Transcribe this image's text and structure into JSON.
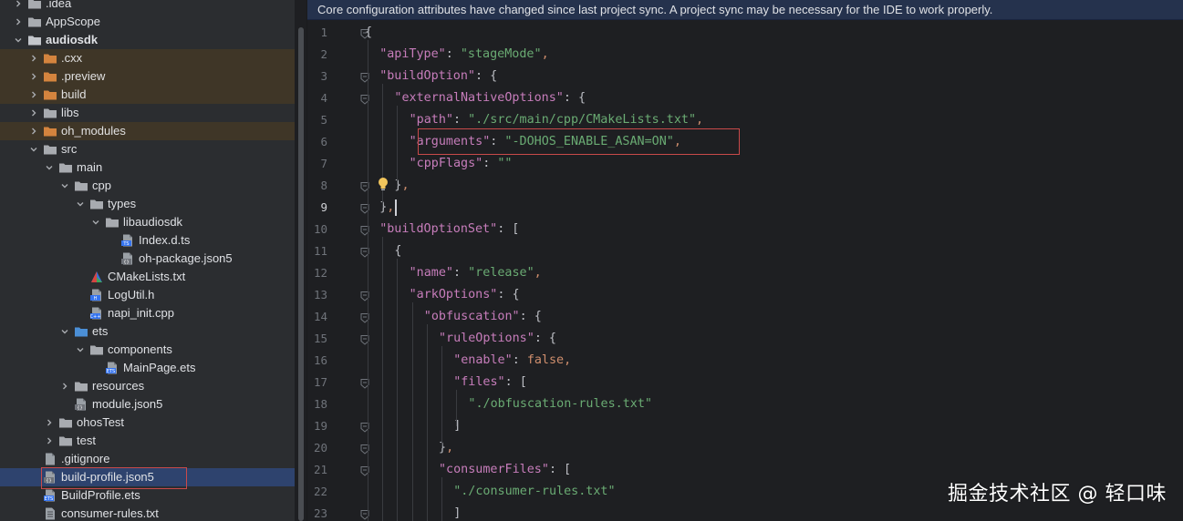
{
  "tree": {
    "items": [
      {
        "label": ".idea",
        "depth": 1,
        "kind": "folder",
        "expanded": false,
        "state": ""
      },
      {
        "label": "AppScope",
        "depth": 1,
        "kind": "folder",
        "expanded": false,
        "state": ""
      },
      {
        "label": "audiosdk",
        "depth": 1,
        "kind": "module",
        "expanded": true,
        "state": "",
        "bold": true
      },
      {
        "label": ".cxx",
        "depth": 2,
        "kind": "folder-orange",
        "expanded": false,
        "state": "excluded"
      },
      {
        "label": ".preview",
        "depth": 2,
        "kind": "folder-orange",
        "expanded": false,
        "state": "excluded"
      },
      {
        "label": "build",
        "depth": 2,
        "kind": "folder-orange",
        "expanded": false,
        "state": "excluded"
      },
      {
        "label": "libs",
        "depth": 2,
        "kind": "folder",
        "expanded": false,
        "state": ""
      },
      {
        "label": "oh_modules",
        "depth": 2,
        "kind": "folder-orange",
        "expanded": false,
        "state": "excluded"
      },
      {
        "label": "src",
        "depth": 2,
        "kind": "folder",
        "expanded": true,
        "state": ""
      },
      {
        "label": "main",
        "depth": 3,
        "kind": "folder",
        "expanded": true,
        "state": ""
      },
      {
        "label": "cpp",
        "depth": 4,
        "kind": "folder",
        "expanded": true,
        "state": ""
      },
      {
        "label": "types",
        "depth": 5,
        "kind": "folder",
        "expanded": true,
        "state": ""
      },
      {
        "label": "libaudiosdk",
        "depth": 6,
        "kind": "folder",
        "expanded": true,
        "state": ""
      },
      {
        "label": "Index.d.ts",
        "depth": 7,
        "kind": "ts",
        "state": ""
      },
      {
        "label": "oh-package.json5",
        "depth": 7,
        "kind": "json5",
        "state": ""
      },
      {
        "label": "CMakeLists.txt",
        "depth": 5,
        "kind": "cmake",
        "state": ""
      },
      {
        "label": "LogUtil.h",
        "depth": 5,
        "kind": "h",
        "state": ""
      },
      {
        "label": "napi_init.cpp",
        "depth": 5,
        "kind": "cpp",
        "state": ""
      },
      {
        "label": "ets",
        "depth": 4,
        "kind": "folder-blue",
        "expanded": true,
        "state": ""
      },
      {
        "label": "components",
        "depth": 5,
        "kind": "folder",
        "expanded": true,
        "state": ""
      },
      {
        "label": "MainPage.ets",
        "depth": 6,
        "kind": "ets",
        "state": ""
      },
      {
        "label": "resources",
        "depth": 4,
        "kind": "folder",
        "expanded": false,
        "state": ""
      },
      {
        "label": "module.json5",
        "depth": 4,
        "kind": "json5",
        "state": ""
      },
      {
        "label": "ohosTest",
        "depth": 3,
        "kind": "folder",
        "expanded": false,
        "state": ""
      },
      {
        "label": "test",
        "depth": 3,
        "kind": "folder",
        "expanded": false,
        "state": ""
      },
      {
        "label": ".gitignore",
        "depth": 2,
        "kind": "gitignore",
        "state": ""
      },
      {
        "label": "build-profile.json5",
        "depth": 2,
        "kind": "json5",
        "state": "selected"
      },
      {
        "label": "BuildProfile.ets",
        "depth": 2,
        "kind": "ets",
        "state": ""
      },
      {
        "label": "consumer-rules.txt",
        "depth": 2,
        "kind": "txt",
        "state": ""
      }
    ]
  },
  "editor": {
    "banner": "Core configuration attributes have changed since last project sync. A project sync may be necessary for the IDE to work properly.",
    "current_line": 9,
    "lines": [
      {
        "n": "1",
        "indent": 0,
        "tokens": [
          [
            "p",
            "{"
          ]
        ]
      },
      {
        "n": "2",
        "indent": 1,
        "tokens": [
          [
            "k",
            "\"apiType\""
          ],
          [
            "p",
            ": "
          ],
          [
            "s",
            "\"stageMode\""
          ],
          [
            "b",
            ","
          ]
        ]
      },
      {
        "n": "3",
        "indent": 1,
        "tokens": [
          [
            "k",
            "\"buildOption\""
          ],
          [
            "p",
            ": {"
          ]
        ]
      },
      {
        "n": "4",
        "indent": 2,
        "tokens": [
          [
            "k",
            "\"externalNativeOptions\""
          ],
          [
            "p",
            ": {"
          ]
        ]
      },
      {
        "n": "5",
        "indent": 3,
        "tokens": [
          [
            "k",
            "\"path\""
          ],
          [
            "p",
            ": "
          ],
          [
            "s",
            "\"./src/main/cpp/CMakeLists.txt\""
          ],
          [
            "b",
            ","
          ]
        ]
      },
      {
        "n": "6",
        "indent": 3,
        "tokens": [
          [
            "k",
            "\"arguments\""
          ],
          [
            "p",
            ": "
          ],
          [
            "s",
            "\"-DOHOS_ENABLE_ASAN=ON\""
          ],
          [
            "b",
            ","
          ]
        ]
      },
      {
        "n": "7",
        "indent": 3,
        "tokens": [
          [
            "k",
            "\"cppFlags\""
          ],
          [
            "p",
            ": "
          ],
          [
            "s",
            "\"\""
          ]
        ]
      },
      {
        "n": "8",
        "indent": 2,
        "tokens": [
          [
            "p",
            "}"
          ],
          [
            "b",
            ","
          ]
        ]
      },
      {
        "n": "9",
        "indent": 1,
        "tokens": [
          [
            "p",
            "}"
          ],
          [
            "b",
            ","
          ]
        ]
      },
      {
        "n": "10",
        "indent": 1,
        "tokens": [
          [
            "k",
            "\"buildOptionSet\""
          ],
          [
            "p",
            ": ["
          ]
        ]
      },
      {
        "n": "11",
        "indent": 2,
        "tokens": [
          [
            "p",
            "{"
          ]
        ]
      },
      {
        "n": "12",
        "indent": 3,
        "tokens": [
          [
            "k",
            "\"name\""
          ],
          [
            "p",
            ": "
          ],
          [
            "s",
            "\"release\""
          ],
          [
            "b",
            ","
          ]
        ]
      },
      {
        "n": "13",
        "indent": 3,
        "tokens": [
          [
            "k",
            "\"arkOptions\""
          ],
          [
            "p",
            ": {"
          ]
        ]
      },
      {
        "n": "14",
        "indent": 4,
        "tokens": [
          [
            "k",
            "\"obfuscation\""
          ],
          [
            "p",
            ": {"
          ]
        ]
      },
      {
        "n": "15",
        "indent": 5,
        "tokens": [
          [
            "k",
            "\"ruleOptions\""
          ],
          [
            "p",
            ": {"
          ]
        ]
      },
      {
        "n": "16",
        "indent": 6,
        "tokens": [
          [
            "k",
            "\"enable\""
          ],
          [
            "p",
            ": "
          ],
          [
            "b",
            "false,"
          ]
        ]
      },
      {
        "n": "17",
        "indent": 6,
        "tokens": [
          [
            "k",
            "\"files\""
          ],
          [
            "p",
            ": ["
          ]
        ]
      },
      {
        "n": "18",
        "indent": 7,
        "tokens": [
          [
            "s",
            "\"./obfuscation-rules.txt\""
          ]
        ]
      },
      {
        "n": "19",
        "indent": 6,
        "tokens": [
          [
            "p",
            "]"
          ]
        ]
      },
      {
        "n": "20",
        "indent": 5,
        "tokens": [
          [
            "p",
            "}"
          ],
          [
            "b",
            ","
          ]
        ]
      },
      {
        "n": "21",
        "indent": 5,
        "tokens": [
          [
            "k",
            "\"consumerFiles\""
          ],
          [
            "p",
            ": ["
          ]
        ]
      },
      {
        "n": "22",
        "indent": 6,
        "tokens": [
          [
            "s",
            "\"./consumer-rules.txt\""
          ]
        ]
      },
      {
        "n": "23",
        "indent": 6,
        "tokens": [
          [
            "p",
            "]"
          ]
        ]
      }
    ],
    "fold_lines": [
      1,
      3,
      4,
      8,
      9,
      10,
      11,
      13,
      14,
      15,
      17,
      19,
      20,
      21,
      23
    ]
  },
  "colors": {
    "key": "#c77dbb",
    "string": "#6aab73",
    "keyword": "#cf8e6d",
    "highlight_box": "#c94a4a",
    "excluded_row": "#3f3627",
    "selected_row": "#2e436e"
  },
  "icons": {
    "intention": "lightbulb-icon",
    "tree_expand": "chevron-icon"
  },
  "watermark": "掘金技术社区 @ 轻口味"
}
